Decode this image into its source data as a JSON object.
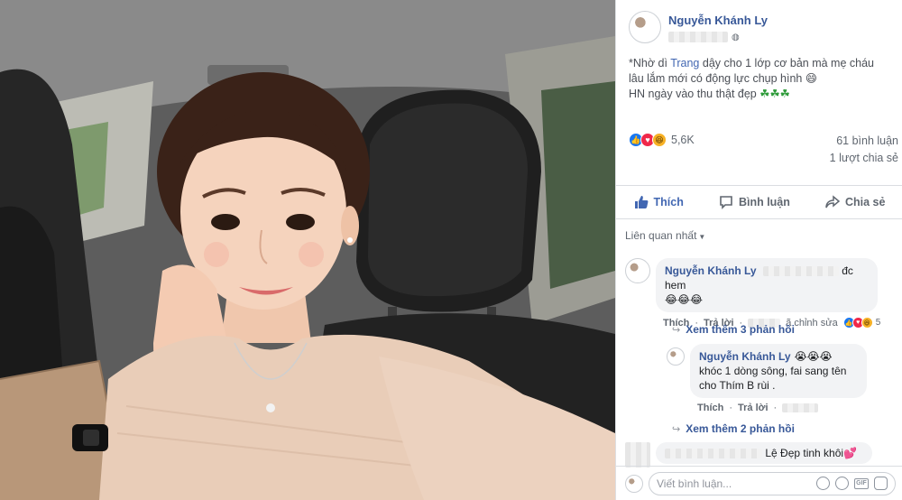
{
  "post": {
    "author": "Nguyễn Khánh Ly",
    "caption_prefix": "*Nhờ dì ",
    "caption_tag": "Trang",
    "caption_rest": " dậy cho 1 lớp cơ bản mà mẹ cháu lâu lắm mới có động lực chụp hình 😄",
    "caption_line2": "HN ngày vào thu thật đẹp ",
    "caption_clovers": "☘☘☘",
    "reaction_count": "5,6K",
    "comment_count": "61 bình luận",
    "share_count": "1 lượt chia sẻ"
  },
  "actions": {
    "like": "Thích",
    "comment": "Bình luận",
    "share": "Chia sẻ"
  },
  "sort_label": "Liên quan nhất",
  "comments": [
    {
      "author": "Nguyễn Khánh Ly",
      "text_tail": "đc hem",
      "emojis": "😂😂😂",
      "like_label": "Thích",
      "reply_label": "Trả lời",
      "edited_tail": "ã chỉnh sửa",
      "reaction_count": "5"
    }
  ],
  "more_replies_1": "Xem thêm 3 phản hồi",
  "reply": {
    "author": "Nguyễn Khánh Ly",
    "emojis": "😭😭😭",
    "text": " khóc 1 dòng sông, fai sang tên cho Thím B rùi .",
    "like_label": "Thích",
    "reply_label": "Trả lời"
  },
  "more_replies_2": "Xem thêm 2 phản hồi",
  "comment_3": {
    "text_tail": "Lệ Đẹp tinh khôi",
    "heart": "💕"
  },
  "composer": {
    "placeholder": "Viết bình luận..."
  },
  "icons": [
    "like-icon",
    "comment-icon",
    "share-icon",
    "emoji-icon",
    "camera-icon",
    "gif-icon",
    "sticker-icon",
    "globe-icon"
  ],
  "colors": {
    "link": "#385898",
    "accent": "#4267b2",
    "bubble": "#f2f3f5"
  }
}
